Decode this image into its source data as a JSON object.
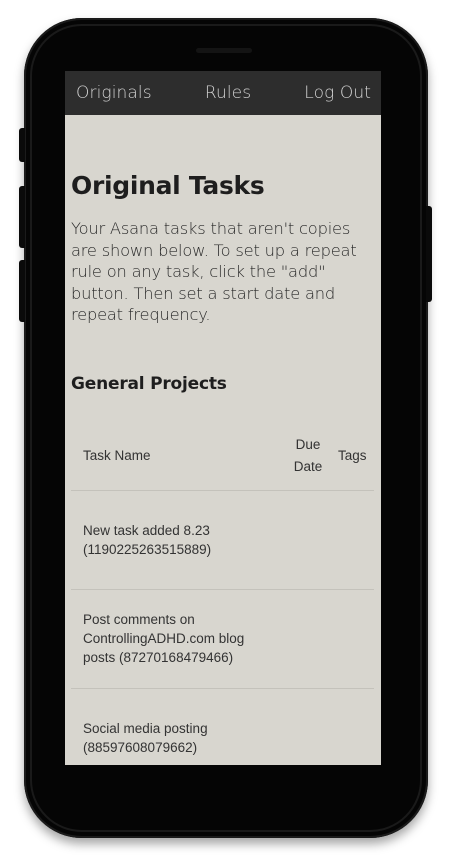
{
  "nav": {
    "items": [
      {
        "label": "Originals"
      },
      {
        "label": "Rules"
      },
      {
        "label": "Log Out"
      }
    ]
  },
  "page": {
    "title": "Original Tasks",
    "intro": "Your Asana tasks that aren't copies are shown below. To set up a repeat rule on any task, click the \"add\" button. Then set a start date and repeat frequency."
  },
  "project": {
    "name": "General Projects",
    "columns": {
      "task_name": "Task Name",
      "due_date": "Due Date",
      "tags": "Tags"
    },
    "tasks": [
      {
        "name": "New task added 8.23 (1190225263515889)",
        "due": "",
        "tags": ""
      },
      {
        "name": "Post comments on ControllingADHD.com blog posts (87270168479466)",
        "due": "",
        "tags": ""
      },
      {
        "name": "Social media posting (88597608079662)",
        "due": "",
        "tags": ""
      }
    ]
  }
}
